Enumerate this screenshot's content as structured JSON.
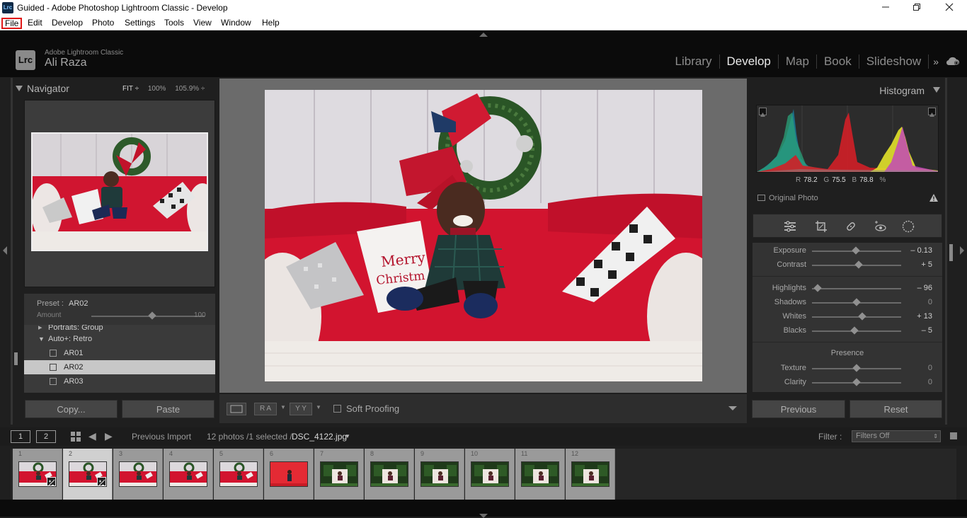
{
  "window": {
    "app_icon": "Lrc",
    "title": "Guided - Adobe Photoshop Lightroom Classic - Develop",
    "controls": [
      "minimize-icon",
      "restore-icon",
      "close-icon"
    ]
  },
  "menu": [
    "File",
    "Edit",
    "Develop",
    "Photo",
    "Settings",
    "Tools",
    "View",
    "Window",
    "Help"
  ],
  "identity": {
    "logo": "Lrc",
    "brand": "Adobe Lightroom Classic",
    "user": "Ali Raza"
  },
  "modules": [
    "Library",
    "Develop",
    "Map",
    "Book",
    "Slideshow"
  ],
  "modules_more": "»",
  "navigator": {
    "title": "Navigator",
    "zoom_fit": "FIT ÷",
    "zoom_100": "100%",
    "zoom_custom": "105.9% ÷"
  },
  "preset": {
    "label": "Preset :",
    "value": "AR02",
    "amount_label": "Amount",
    "amount_value": "100",
    "amount_fraction": 0.51
  },
  "preset_list": [
    {
      "text": "Portraits: Group",
      "type": "group-collapsed"
    },
    {
      "text": "Auto+: Retro",
      "type": "group-expanded"
    },
    {
      "text": "AR01",
      "type": "preset"
    },
    {
      "text": "AR02",
      "type": "preset-selected"
    },
    {
      "text": "AR03",
      "type": "preset"
    }
  ],
  "left_buttons": {
    "copy": "Copy...",
    "paste": "Paste"
  },
  "toolbar": {
    "view_loupe": "",
    "view_before_after": "R A",
    "view_yy": "Y Y",
    "soft_proofing": "Soft Proofing"
  },
  "histogram": {
    "title": "Histogram",
    "r_label": "R",
    "r": "78.2",
    "g_label": "G",
    "g": "75.5",
    "b_label": "B",
    "b": "78.8",
    "pct": "%",
    "original_photo": "Original Photo"
  },
  "basic": {
    "sliders_group1": [
      {
        "label": "Exposure",
        "value": "– 0.13",
        "fraction": 0.49
      },
      {
        "label": "Contrast",
        "value": "+ 5",
        "fraction": 0.52
      }
    ],
    "sliders_group2": [
      {
        "label": "Highlights",
        "value": "– 96",
        "fraction": 0.06
      },
      {
        "label": "Shadows",
        "value": "0",
        "fraction": 0.5
      },
      {
        "label": "Whites",
        "value": "+ 13",
        "fraction": 0.56
      },
      {
        "label": "Blacks",
        "value": "– 5",
        "fraction": 0.48
      }
    ],
    "presence_title": "Presence",
    "sliders_group3": [
      {
        "label": "Texture",
        "value": "0",
        "fraction": 0.5
      },
      {
        "label": "Clarity",
        "value": "0",
        "fraction": 0.5
      }
    ]
  },
  "right_buttons": {
    "previous": "Previous",
    "reset": "Reset"
  },
  "filmstrip_bar": {
    "screen1": "1",
    "screen2": "2",
    "source": "Previous Import",
    "count": "12 photos /1 selected /",
    "filename": "DSC_4122.jpg",
    "filter_label": "Filter :",
    "filter_value": "Filters Off"
  },
  "filmstrip": [
    {
      "n": "1",
      "kind": "red",
      "badge": true
    },
    {
      "n": "2",
      "kind": "red",
      "badge": true,
      "selected": true
    },
    {
      "n": "3",
      "kind": "red"
    },
    {
      "n": "4",
      "kind": "red"
    },
    {
      "n": "5",
      "kind": "red"
    },
    {
      "n": "6",
      "kind": "redbg"
    },
    {
      "n": "7",
      "kind": "green"
    },
    {
      "n": "8",
      "kind": "green"
    },
    {
      "n": "9",
      "kind": "green"
    },
    {
      "n": "10",
      "kind": "green"
    },
    {
      "n": "11",
      "kind": "green"
    },
    {
      "n": "12",
      "kind": "green"
    }
  ]
}
